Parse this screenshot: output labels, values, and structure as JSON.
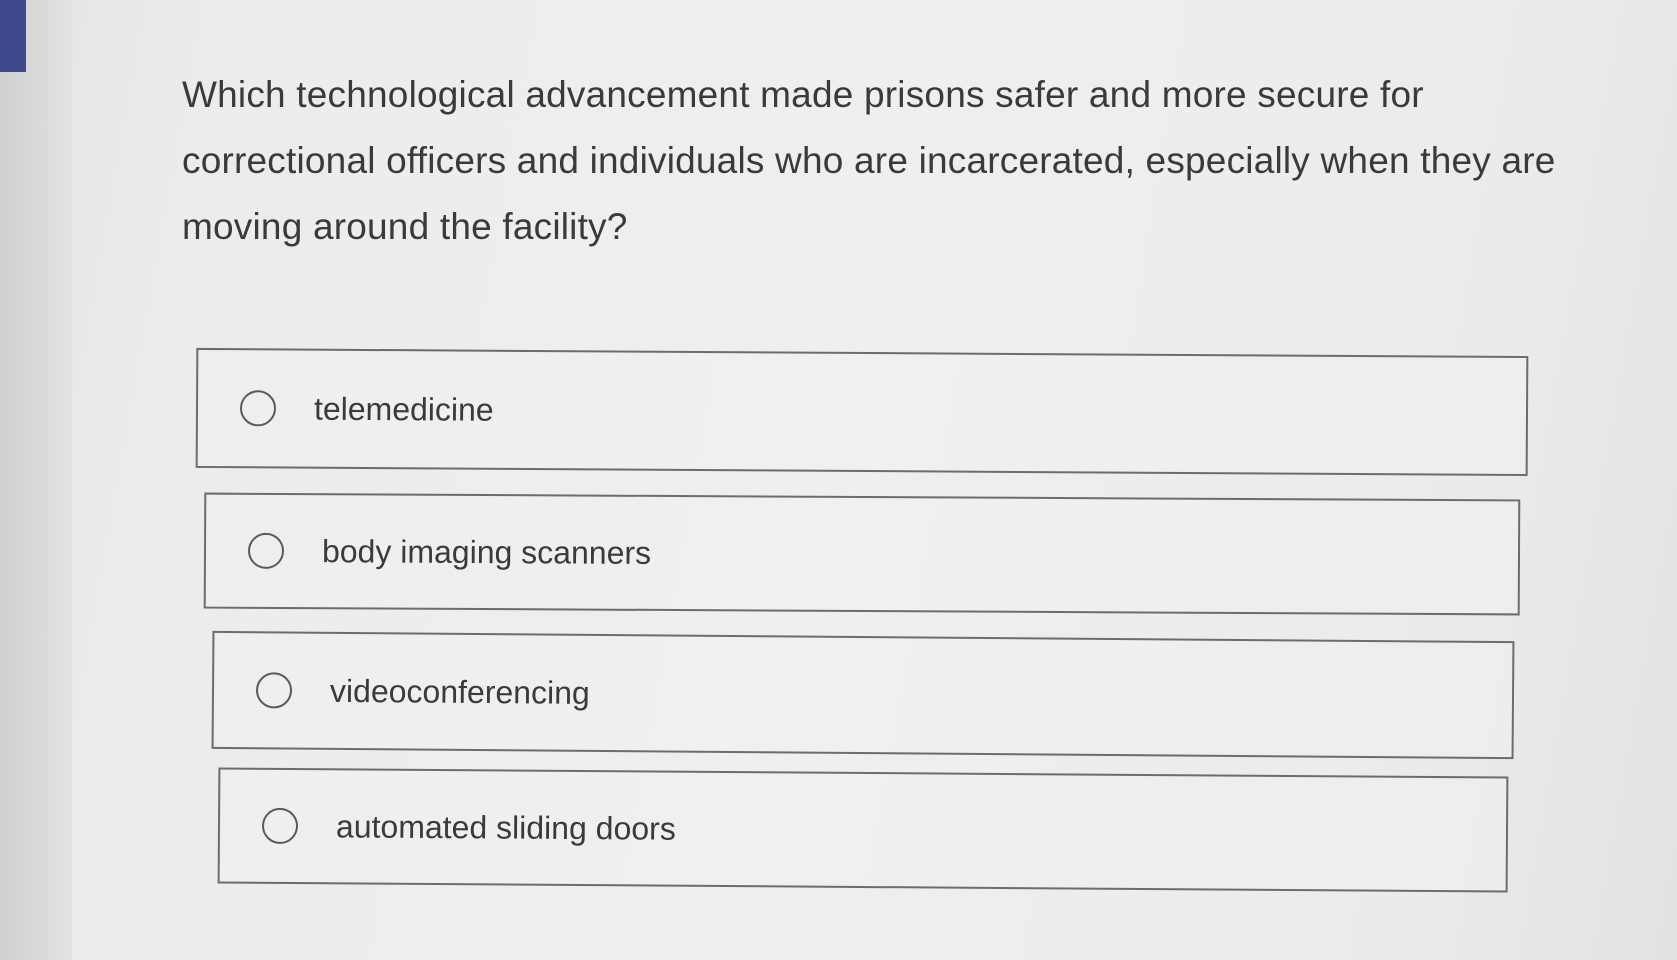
{
  "question": {
    "text": "Which technological advancement made prisons safer and more secure for correctional officers and individuals who are incarcerated, especially when they are moving around the facility?"
  },
  "options": [
    {
      "label": "telemedicine",
      "selected": false
    },
    {
      "label": "body imaging scanners",
      "selected": false
    },
    {
      "label": "videoconferencing",
      "selected": false
    },
    {
      "label": "automated sliding doors",
      "selected": false
    }
  ],
  "colors": {
    "corner_tab": "#3c4a8c",
    "text": "#3a3a3a",
    "border": "#6c6c6c"
  }
}
